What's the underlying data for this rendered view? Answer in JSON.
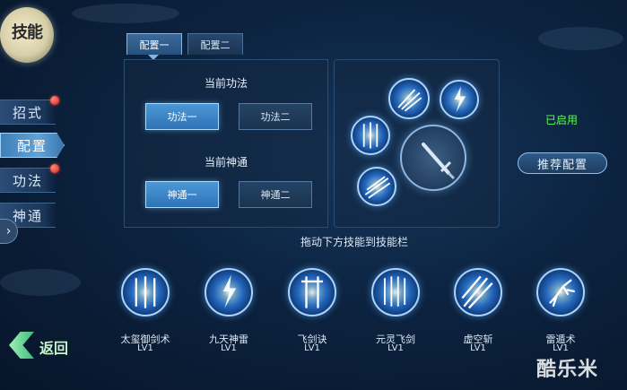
{
  "title": "技能",
  "nav": {
    "items": [
      {
        "label": "招式",
        "active": false,
        "badge": true
      },
      {
        "label": "配置",
        "active": true,
        "badge": false
      },
      {
        "label": "功法",
        "active": false,
        "badge": true
      },
      {
        "label": "神通",
        "active": false,
        "badge": false
      }
    ],
    "expand_icon": "›"
  },
  "tabs": [
    {
      "label": "配置一",
      "active": true
    },
    {
      "label": "配置二",
      "active": false
    }
  ],
  "config": {
    "gongfa_title": "当前功法",
    "gongfa_options": [
      {
        "label": "功法一",
        "active": true
      },
      {
        "label": "功法二",
        "active": false
      }
    ],
    "shentong_title": "当前神通",
    "shentong_options": [
      {
        "label": "神通一",
        "active": true
      },
      {
        "label": "神通二",
        "active": false
      }
    ]
  },
  "loadout": {
    "status": "已启用",
    "recommend_label": "推荐配置"
  },
  "drag_hint": "拖动下方技能到技能栏",
  "skills": [
    {
      "name": "太玺御剑术",
      "level": "LV1",
      "icon": "sword-formation-icon"
    },
    {
      "name": "九天神雷",
      "level": "LV1",
      "icon": "thunder-icon"
    },
    {
      "name": "飞剑诀",
      "level": "LV1",
      "icon": "flying-sword-icon"
    },
    {
      "name": "元灵飞剑",
      "level": "LV1",
      "icon": "spirit-swords-icon"
    },
    {
      "name": "虚空斩",
      "level": "LV1",
      "icon": "void-slash-icon"
    },
    {
      "name": "雷遁术",
      "level": "LV1",
      "icon": "lightning-stag-icon"
    }
  ],
  "back_label": "返回",
  "watermark": "酷乐米",
  "colors": {
    "accent": "#4c98d8",
    "enabled": "#5dff4e",
    "badge": "#d0201a",
    "back": "#3fb97a"
  }
}
